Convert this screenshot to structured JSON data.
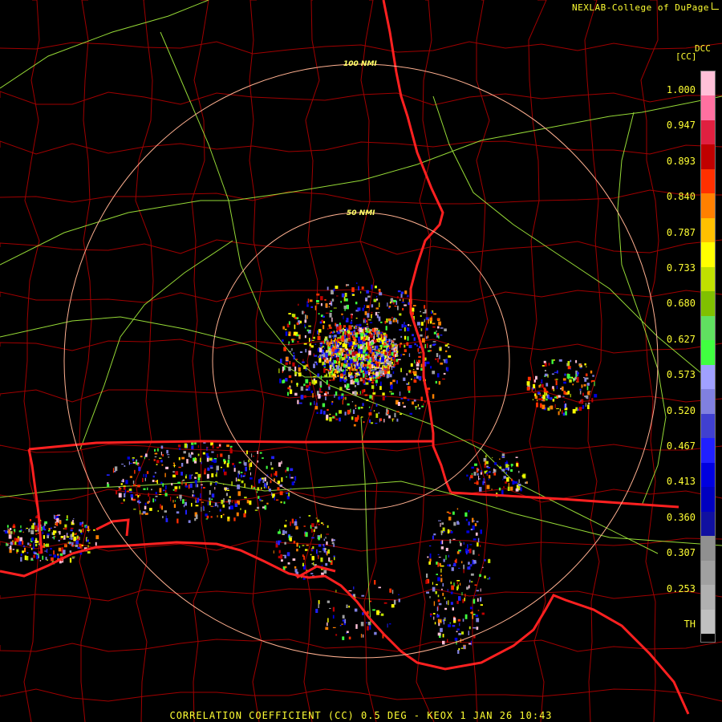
{
  "header": {
    "credit": "NEXLAB-College of DuPage"
  },
  "legend": {
    "product": "DCC",
    "unit": "[CC]",
    "ticks": [
      "1.000",
      "0.947",
      "0.893",
      "0.840",
      "0.787",
      "0.733",
      "0.680",
      "0.627",
      "0.573",
      "0.520",
      "0.467",
      "0.413",
      "0.360",
      "0.307",
      "0.253",
      "TH"
    ],
    "colors": [
      "#ffc0d8",
      "#ff70a0",
      "#e02040",
      "#c00000",
      "#ff3000",
      "#ff8000",
      "#ffc000",
      "#ffff00",
      "#c0e000",
      "#80c000",
      "#60e060",
      "#40ff40",
      "#a0a0ff",
      "#8080e0",
      "#4040d0",
      "#2020ff",
      "#0000e0",
      "#0000c0",
      "#1010a0",
      "#909090",
      "#a0a0a0",
      "#b0b0b0",
      "#c0c0c0"
    ]
  },
  "range_rings": [
    "50 NMI",
    "100 NMI"
  ],
  "footer": {
    "caption": "CORRELATION COEFFICIENT (CC) 0.5 DEG - KEOX 1 JAN 26 10:43"
  },
  "colors": {
    "county_lines": "#b00000",
    "state_lines": "#ff2020",
    "highways": "#c0ff40",
    "rings": "#ffb090",
    "text": "#ffff33"
  }
}
